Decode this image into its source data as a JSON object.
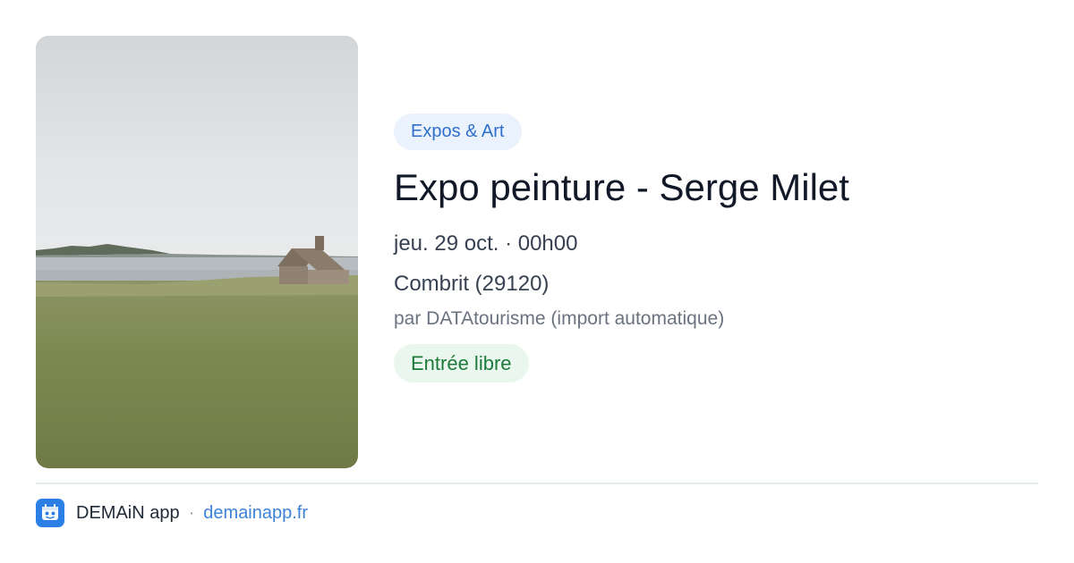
{
  "event": {
    "category": "Expos & Art",
    "title": "Expo peinture - Serge Milet",
    "datetime": "jeu. 29 oct. · 00h00",
    "location": "Combrit (29120)",
    "source": "par DATAtourisme (import automatique)",
    "price": "Entrée libre"
  },
  "footer": {
    "app_name": "DEMAiN app",
    "separator": "·",
    "site": "demainapp.fr"
  },
  "icons": {
    "app_logo": "demain-app-logo-icon"
  },
  "colors": {
    "tag_bg": "#eaf2fd",
    "tag_text": "#2f6fcb",
    "price_bg": "#eaf7ee",
    "price_text": "#1d7a3a",
    "link": "#3b82d8",
    "brand": "#2b7fe6"
  }
}
